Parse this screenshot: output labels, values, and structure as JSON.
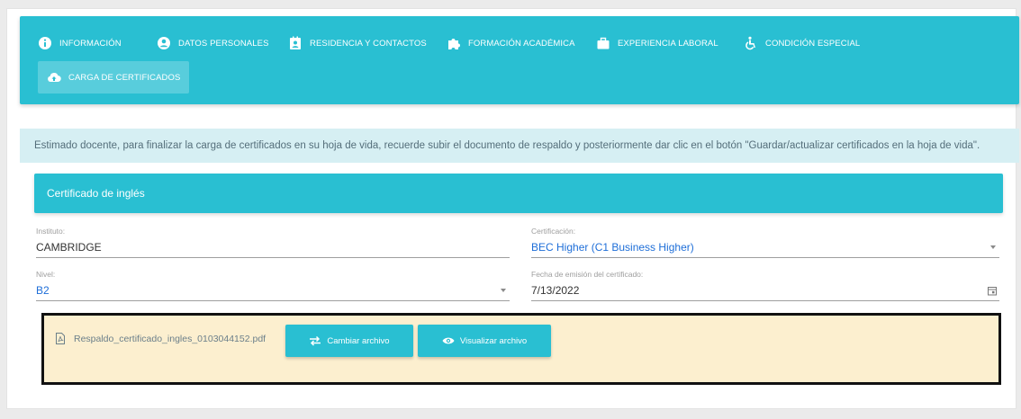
{
  "nav": {
    "items": [
      {
        "label": "INFORMACIÓN",
        "icon": "info-icon"
      },
      {
        "label": "DATOS PERSONALES",
        "icon": "user-circle-icon"
      },
      {
        "label": "RESIDENCIA Y CONTACTOS",
        "icon": "contacts-icon"
      },
      {
        "label": "FORMACIÓN ACADÉMICA",
        "icon": "puzzle-icon"
      },
      {
        "label": "EXPERIENCIA LABORAL",
        "icon": "briefcase-icon"
      },
      {
        "label": "CONDICIÓN ESPECIAL",
        "icon": "accessibility-icon"
      },
      {
        "label": "CARGA DE CERTIFICADOS",
        "icon": "cloud-upload-icon"
      }
    ],
    "active_index": 6
  },
  "notice": "Estimado docente, para finalizar la carga de certificados en su hoja de vida, recuerde subir el documento de respaldo y posteriormente dar clic en el botón \"Guardar/actualizar certificados en la hoja de vida\".",
  "card": {
    "title": "Certificado de inglés"
  },
  "form": {
    "instituto": {
      "label": "Instituto:",
      "value": "CAMBRIDGE"
    },
    "certificacion": {
      "label": "Certificación:",
      "value": "BEC Higher (C1 Business Higher)"
    },
    "nivel": {
      "label": "Nivel:",
      "value": "B2"
    },
    "fecha": {
      "label": "Fecha de emisión del certificado:",
      "value": "7/13/2022"
    }
  },
  "file": {
    "name": "Respaldo_certificado_ingles_0103044152.pdf",
    "change_label": "Cambiar archivo",
    "view_label": "Visualizar archivo"
  },
  "colors": {
    "accent": "#29bfd2",
    "notice_bg": "#d6eff3",
    "file_bg": "#fcefcf",
    "link_value": "#1e6ed8"
  }
}
